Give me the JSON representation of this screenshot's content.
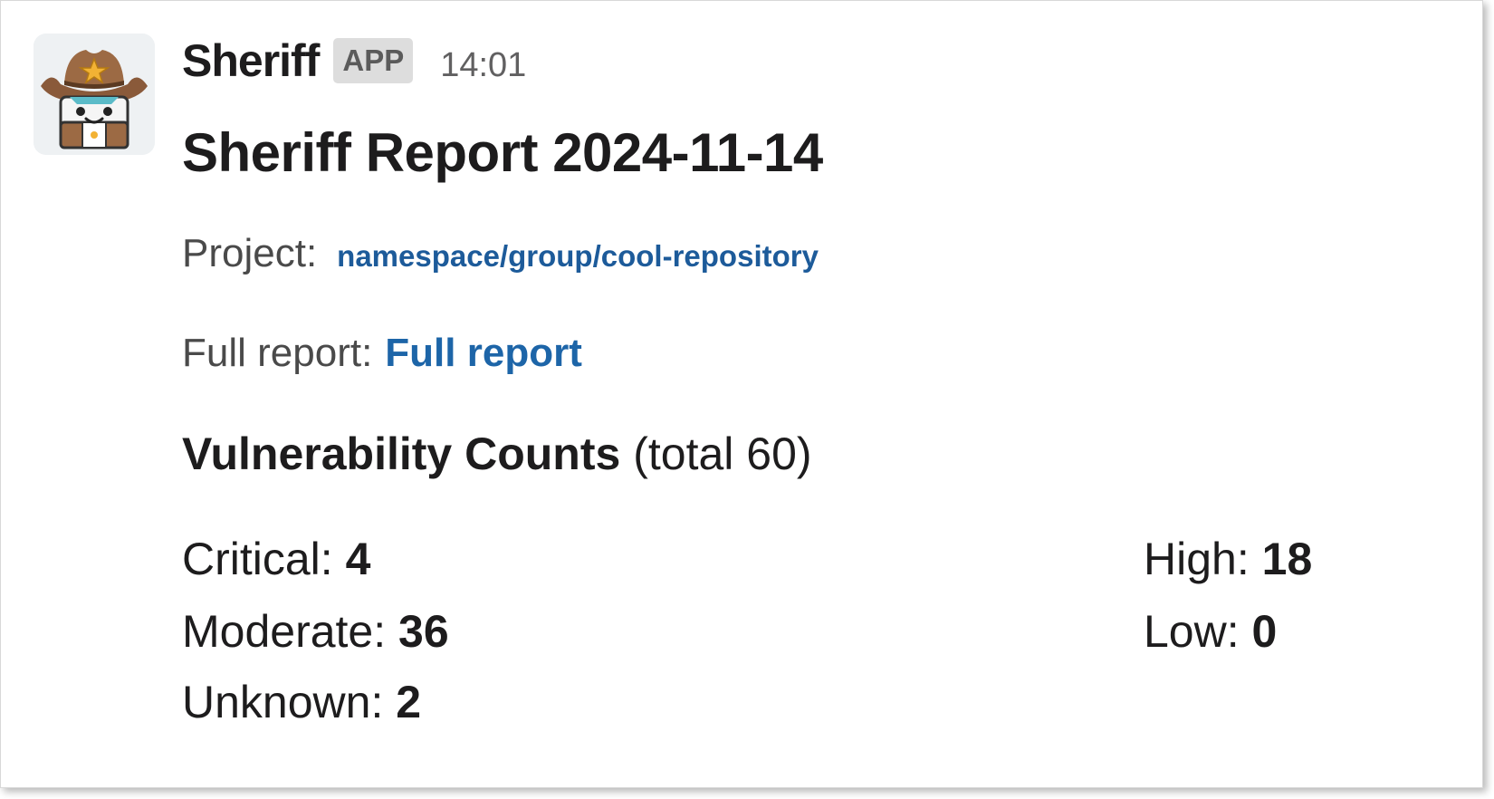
{
  "message": {
    "sender": "Sheriff",
    "app_badge": "APP",
    "time": "14:01",
    "avatar_icon": "sheriff-robot-avatar"
  },
  "report": {
    "title": "Sheriff Report 2024-11-14",
    "project_label": "Project:",
    "project_link": "namespace/group/cool-repository",
    "full_report_label": "Full report:",
    "full_report_link": "Full report",
    "vuln_heading": "Vulnerability Counts",
    "vuln_total": "(total 60)",
    "counts": {
      "critical": {
        "label": "Critical:",
        "value": "4"
      },
      "moderate": {
        "label": "Moderate:",
        "value": "36"
      },
      "unknown": {
        "label": "Unknown:",
        "value": "2"
      },
      "high": {
        "label": "High:",
        "value": "18"
      },
      "low": {
        "label": "Low:",
        "value": "0"
      }
    }
  },
  "colors": {
    "link": "#1d65a8",
    "text": "#1d1c1d",
    "muted": "#616061",
    "badge_bg": "#dddddd"
  }
}
